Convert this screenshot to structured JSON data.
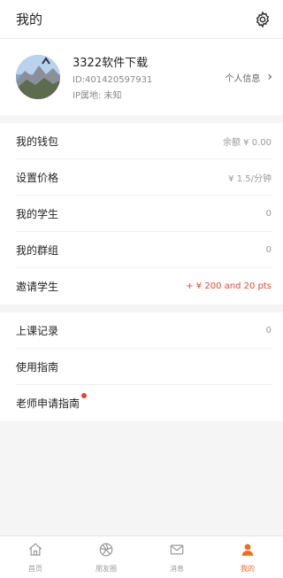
{
  "header": {
    "title": "我的",
    "settings_icon": "gear-icon"
  },
  "profile": {
    "name": "3322软件下载",
    "id_text": "ID:401420597931",
    "ip_text": "IP属地: 未知",
    "link_label": "个人信息",
    "chevron": "›"
  },
  "section1": [
    {
      "label": "我的钱包",
      "value": "余额 ¥ 0.00"
    },
    {
      "label": "设置价格",
      "value": "¥ 1.5/分钟"
    },
    {
      "label": "我的学生",
      "value": "0"
    },
    {
      "label": "我的群组",
      "value": "0"
    },
    {
      "label": "邀请学生",
      "value": "+ ¥ 200 and 20 pts"
    }
  ],
  "section2": [
    {
      "label": "上课记录",
      "value": "0"
    },
    {
      "label": "使用指南",
      "value": ""
    },
    {
      "label": "老师申请指南",
      "value": ""
    }
  ],
  "tabs": [
    {
      "label": "首页",
      "icon": "home-icon"
    },
    {
      "label": "朋友圈",
      "icon": "aperture-icon"
    },
    {
      "label": "消息",
      "icon": "mail-icon"
    },
    {
      "label": "我的",
      "icon": "person-icon"
    }
  ],
  "colors": {
    "accent": "#f26b1d",
    "red": "#e8472e"
  }
}
